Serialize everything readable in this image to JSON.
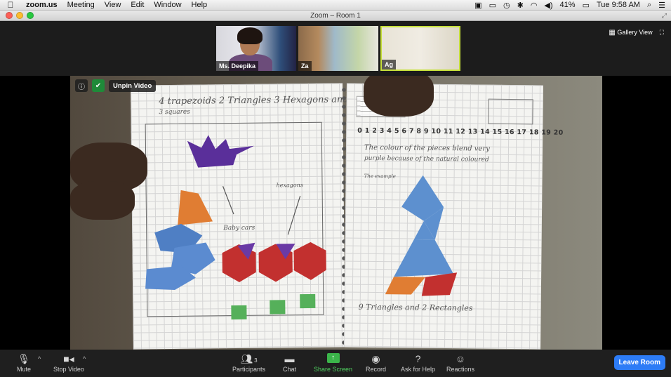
{
  "menubar": {
    "app": "zoom.us",
    "items": [
      "Meeting",
      "View",
      "Edit",
      "Window",
      "Help"
    ],
    "battery": "41%",
    "clock": "Tue 9:58 AM"
  },
  "window": {
    "title": "Zoom – Room 1"
  },
  "thumbnails": [
    {
      "name": "Ms. Deepika"
    },
    {
      "name": "Za"
    },
    {
      "name": "Ag"
    }
  ],
  "gallery_view_label": "Gallery View",
  "video": {
    "unpin_label": "Unpin Video",
    "notebook": {
      "left_heading": "4 trapezoids 2 Triangles 3 Hexagons and",
      "left_heading_2": "3 squares",
      "label_baby_cars": "Baby cars",
      "label_hexagons": "hexagons",
      "number_line": "0 1 2 3 4 5 6 7 8 9 10 11 12 13 14 15 16 17 18 19 20",
      "right_note_1": "The colour of the pieces blend very",
      "right_note_2": "purple because of the natural coloured",
      "right_note_3": "The example",
      "right_bottom": "9 Triangles and 2 Rectangles"
    }
  },
  "toolbar": {
    "mute": "Mute",
    "stop_video": "Stop Video",
    "participants": "Participants",
    "participants_count": "3",
    "chat": "Chat",
    "share_screen": "Share Screen",
    "record": "Record",
    "ask_for_help": "Ask for Help",
    "reactions": "Reactions",
    "leave_room": "Leave Room"
  },
  "colors": {
    "accent_green": "#3bb54a",
    "leave_blue": "#2d7cf6",
    "active_border": "#c6e03a"
  }
}
